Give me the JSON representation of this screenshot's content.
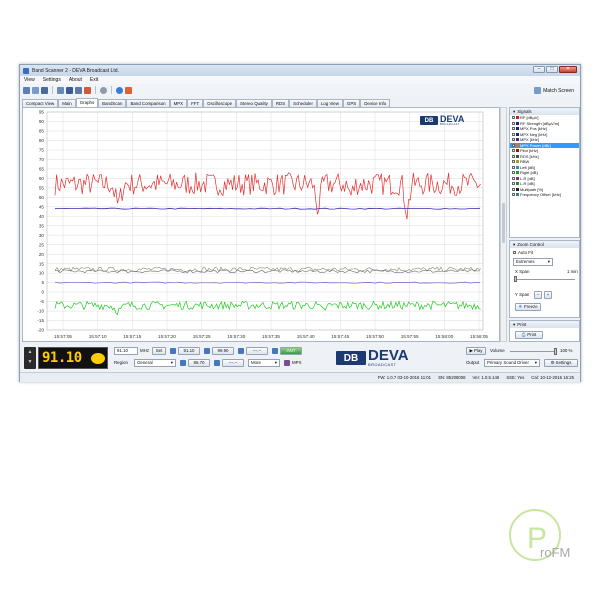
{
  "window": {
    "title": "Band Scanner 2 - DEVA Broadcast Ltd."
  },
  "menu": [
    "View",
    "Settings",
    "About",
    "Exit"
  ],
  "toolbar": {
    "match_screen_label": "Match Screen"
  },
  "tabs": [
    "Compact View",
    "Main",
    "Graphs",
    "BandScan",
    "Band Comparison",
    "MPX",
    "FFT",
    "Oscilloscope",
    "Stereo Quality",
    "RDS",
    "Scheduler",
    "Log View",
    "GPS",
    "Device Info"
  ],
  "active_tab": "Graphs",
  "brand": {
    "name": "DEVA",
    "mark": "DB",
    "sub": "BROADCAST"
  },
  "graph": {
    "y_ticks": [
      "95",
      "90",
      "85",
      "80",
      "75",
      "70",
      "65",
      "60",
      "55",
      "50",
      "45",
      "40",
      "35",
      "30",
      "25",
      "20",
      "15",
      "10",
      "5",
      "0",
      "-5",
      "-10",
      "-15",
      "-20"
    ],
    "x_ticks": [
      "15:57:05",
      "15:57:10",
      "15:57:15",
      "15:57:20",
      "15:57:25",
      "15:57:30",
      "15:57:35",
      "15:57:40",
      "15:57:45",
      "15:57:50",
      "15:57:55",
      "15:58:00",
      "15:58:05"
    ],
    "ylim": [
      -20,
      95
    ],
    "series_colors": {
      "rf": "#e53030",
      "pilot": "#3a2ca8",
      "mid1": "#8a8a5a",
      "mid2": "#5a6a8a",
      "low": "#7a5cc8",
      "bottom": "#22cc22"
    },
    "levels": {
      "rf": 57,
      "pilot": 44,
      "mid1": 12,
      "mid2": 11,
      "low": 5,
      "bottom": -7
    }
  },
  "signals": {
    "header": "Signals",
    "items": [
      {
        "label": "RF [dBµV]",
        "color": "#d02020",
        "checked": true
      },
      {
        "label": "RF Strength [dBµV/m]",
        "color": "#20208a",
        "checked": false
      },
      {
        "label": "MPX Pos [kHz]",
        "color": "#20207a",
        "checked": false
      },
      {
        "label": "MPX Neg [kHz]",
        "color": "#103060",
        "checked": false
      },
      {
        "label": "MPX [kHz]",
        "color": "#602080",
        "checked": false
      },
      {
        "label": "MPX Power [dBr]",
        "color": "#e07020",
        "checked": true,
        "selected": true
      },
      {
        "label": "Pilot [kHz]",
        "color": "#8a1a1a",
        "checked": true
      },
      {
        "label": "RDS [kHz]",
        "color": "#2a6a2a",
        "checked": false
      },
      {
        "label": "RBW",
        "color": "#a0a020",
        "checked": false
      },
      {
        "label": "Left [dB]",
        "color": "#20a0a0",
        "checked": false
      },
      {
        "label": "Right [dB]",
        "color": "#20a020",
        "checked": false
      },
      {
        "label": "L-R [dB]",
        "color": "#8a2a8a",
        "checked": false
      },
      {
        "label": "L-R [dB]",
        "color": "#2a8a2a",
        "checked": false
      },
      {
        "label": "Multipath [%]",
        "color": "#202020",
        "checked": false
      },
      {
        "label": "Frequency Offset [kHz]",
        "color": "#2a8a8a",
        "checked": false
      }
    ]
  },
  "zoom": {
    "header": "Zoom Control",
    "auto_fit": "Auto Fit",
    "mode": "Extremes",
    "x_span_label": "X Span",
    "x_span_value": "1 min",
    "y_span_label": "Y Span",
    "freeze_label": "Freeze"
  },
  "print": {
    "header": "Print",
    "button": "Print"
  },
  "tuner": {
    "frequency": "91.10",
    "freq_input": "91.10",
    "unit": "MHz",
    "set": "Set",
    "region_label": "Region",
    "region": "General",
    "mem1": "91.10",
    "mem2": "99.90",
    "mem3": "---.--",
    "mem4": "95.70",
    "mem5": "---.--",
    "more": "More",
    "ant": "ANT",
    "mpx": "MPX"
  },
  "audio": {
    "play": "Play",
    "volume_label": "Volume",
    "volume_value": "100 %",
    "volume_level": 1.0,
    "output_label": "Output",
    "output_device": "Primary Sound Driver",
    "settings": "Settings"
  },
  "status": {
    "fw": "FW: 1.0.7 03-10-2016 11:01",
    "sn": "SN: 85208008",
    "ver": "Ver: 1.0.5.146",
    "ssl": "SSE: Yes",
    "cal": "Cal: 10-12-2016 16:25"
  },
  "watermark": {
    "text": "roFM",
    "letter": "P"
  }
}
